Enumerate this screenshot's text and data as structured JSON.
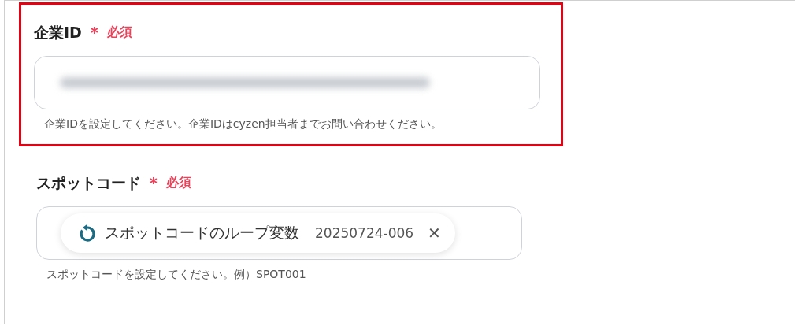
{
  "fields": [
    {
      "label": "企業ID",
      "required_mark": "＊",
      "required_text": "必須",
      "highlighted": true,
      "value": {
        "kind": "redacted"
      },
      "hint": "企業IDを設定してください。企業IDはcyzen担当者までお問い合わせください。"
    },
    {
      "label": "スポットコード",
      "required_mark": "＊",
      "required_text": "必須",
      "highlighted": false,
      "value": {
        "kind": "chip",
        "name": "スポットコードのループ変数",
        "sample": "20250724-006",
        "remove": "✕"
      },
      "hint": "スポットコードを設定してください。例）SPOT001"
    }
  ]
}
